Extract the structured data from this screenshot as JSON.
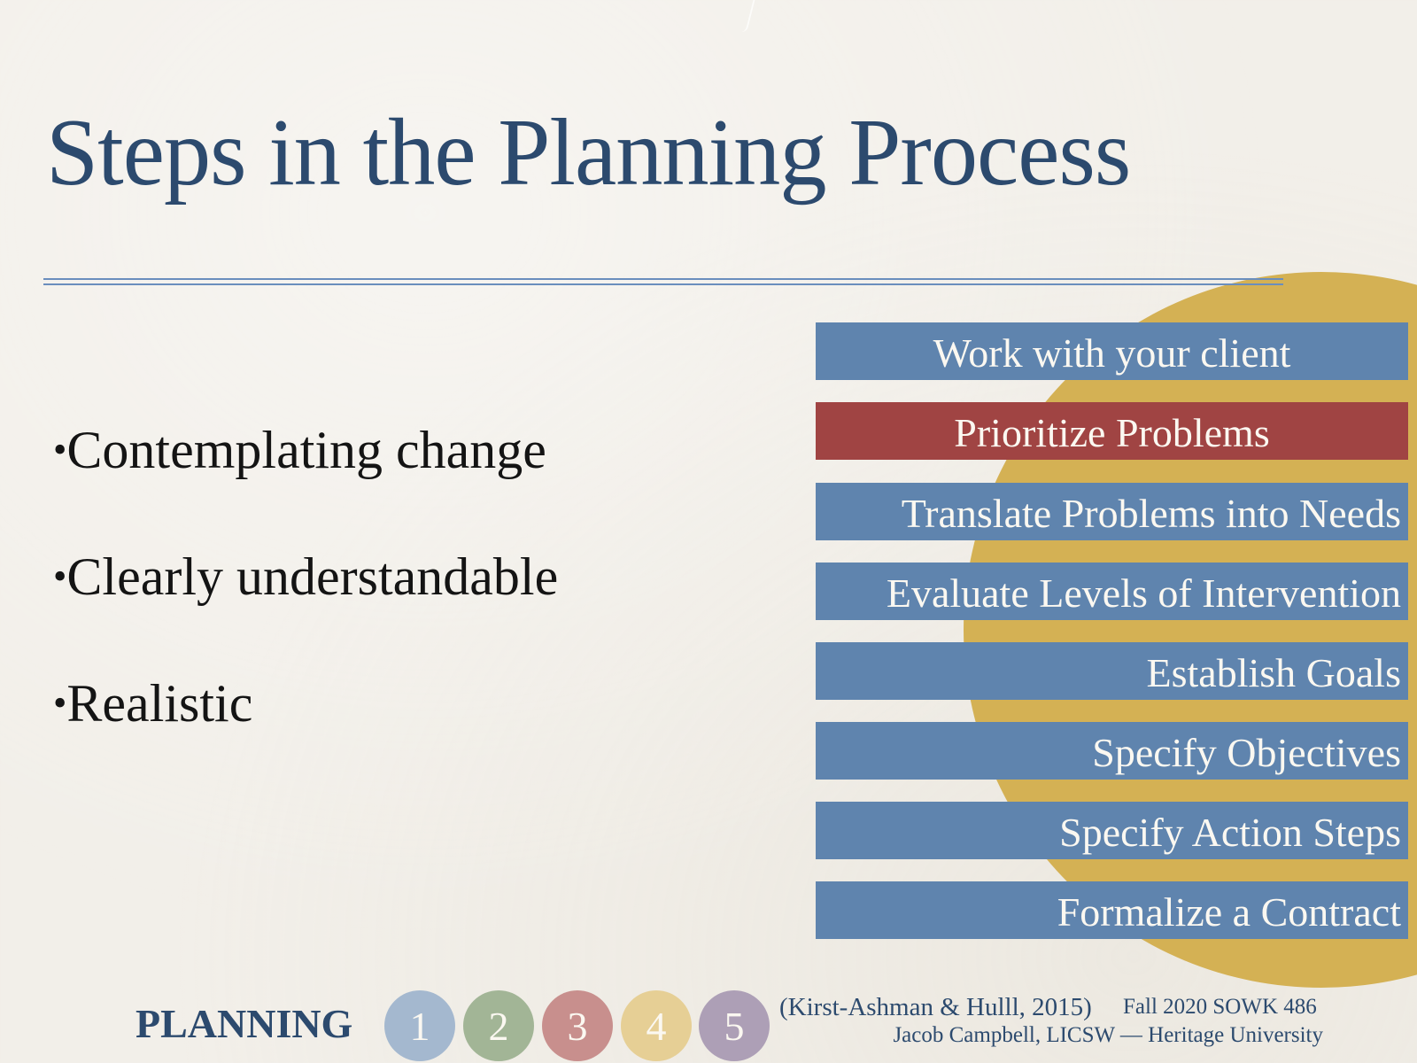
{
  "slide": {
    "title": "Steps in the Planning Process",
    "bullets": [
      {
        "marker": "•",
        "text": "Contemplating change"
      },
      {
        "marker": "•",
        "text": "Clearly understandable"
      },
      {
        "marker": "•",
        "text": "Realistic"
      }
    ],
    "steps": [
      {
        "label": "Work with your client",
        "active": false
      },
      {
        "label": "Prioritize Problems",
        "active": true
      },
      {
        "label": "Translate Problems into Needs",
        "active": false
      },
      {
        "label": "Evaluate Levels of Intervention",
        "active": false
      },
      {
        "label": "Establish Goals",
        "active": false
      },
      {
        "label": "Specify Objectives",
        "active": false
      },
      {
        "label": "Specify Action Steps",
        "active": false
      },
      {
        "label": "Formalize a Contract",
        "active": false
      }
    ],
    "colors": {
      "title": "#2c4a6e",
      "step_default": "#5f84ae",
      "step_active": "#a04443",
      "accent_circle": "#d4b154",
      "rule": "#6a8ebd"
    }
  },
  "footer": {
    "section_label": "PLANNING",
    "phases": [
      {
        "number": "1",
        "color": "#a4b8cf"
      },
      {
        "number": "2",
        "color": "#a2b596"
      },
      {
        "number": "3",
        "color": "#c88f8d"
      },
      {
        "number": "4",
        "color": "#e6cf95"
      },
      {
        "number": "5",
        "color": "#ad9fb6"
      }
    ],
    "citation": "(Kirst-Ashman & Hulll, 2015)",
    "course": "Fall 2020 SOWK 486",
    "author": "Jacob Campbell, LICSW — Heritage University"
  }
}
